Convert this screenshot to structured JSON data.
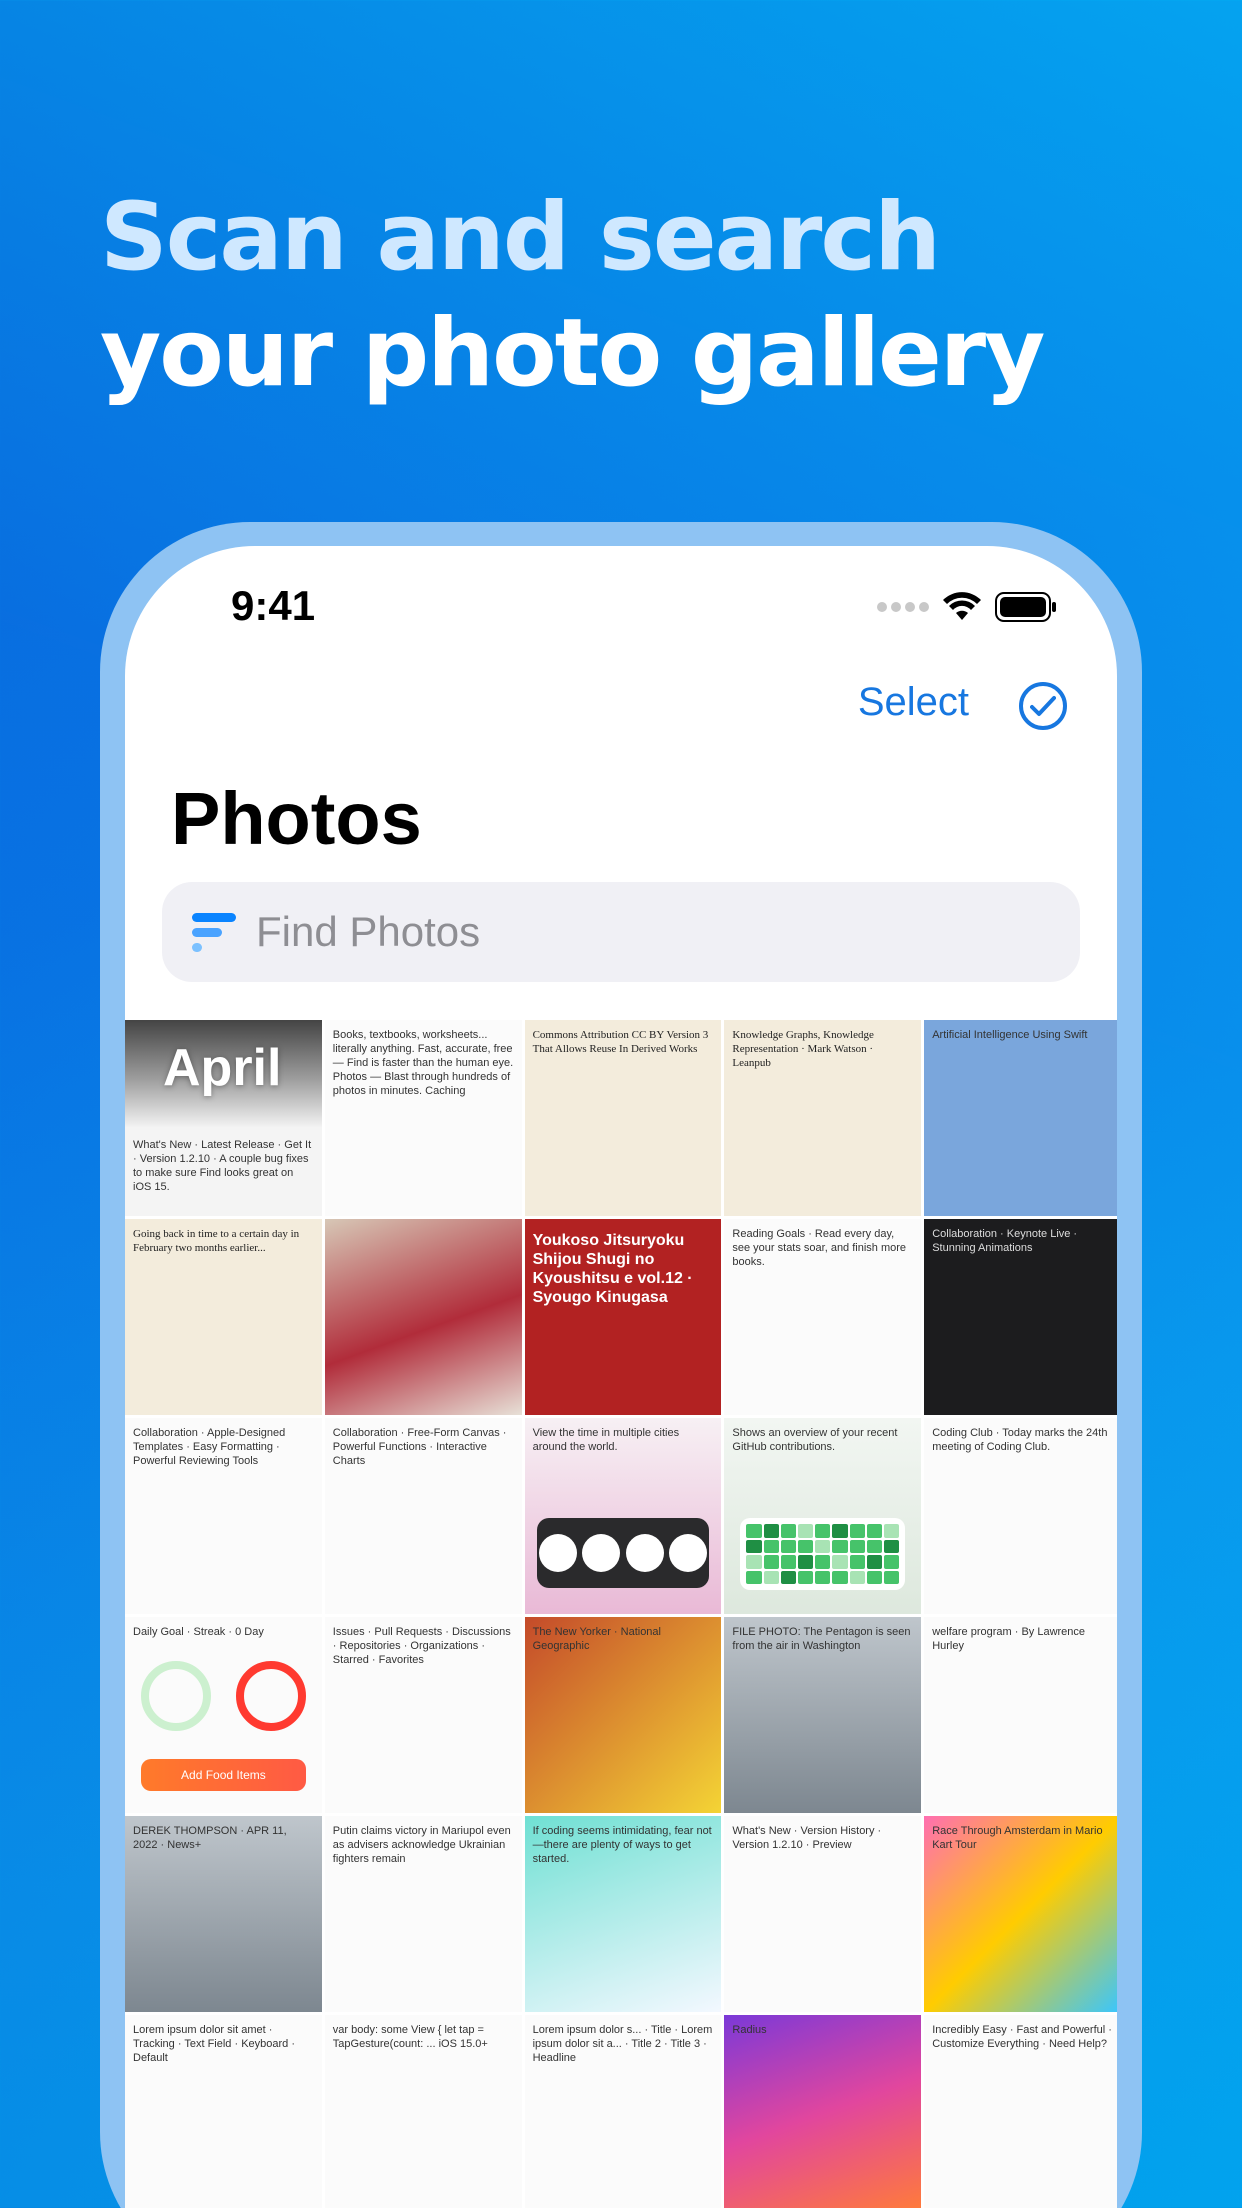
{
  "headline": {
    "line1": "Scan and search",
    "line2": "your photo gallery"
  },
  "status": {
    "time": "9:41"
  },
  "nav": {
    "select_label": "Select"
  },
  "page": {
    "title": "Photos"
  },
  "search": {
    "placeholder": "Find Photos"
  },
  "grid": {
    "section_label": "April",
    "tiles": [
      {
        "name": "whats-new-tile",
        "style": "april-tile",
        "caption": "What's New · Latest Release · Get It · Version 1.2.10 · A couple bug fixes to make sure Find looks great on iOS 15."
      },
      {
        "name": "features-list-tile",
        "style": "light",
        "caption": "Books, textbooks, worksheets... literally anything. Fast, accurate, free — Find is faster than the human eye. Photos — Blast through hundreds of photos in minutes. Caching"
      },
      {
        "name": "license-page-tile",
        "style": "paper",
        "caption": "Commons Attribution CC BY Version 3 That Allows Reuse In Derived Works"
      },
      {
        "name": "book-title-page-tile",
        "style": "paper",
        "caption": "Knowledge Graphs, Knowledge Representation · Mark Watson · Leanpub"
      },
      {
        "name": "book-cover-ai-tile",
        "style": "blue",
        "caption": "Artificial Intelligence Using Swift"
      },
      {
        "name": "novel-page-tile",
        "style": "paper",
        "caption": "Going back in time to a certain day in February two months earlier..."
      },
      {
        "name": "anime-cover-tile",
        "style": "anime",
        "caption": ""
      },
      {
        "name": "novel-cover-tile",
        "style": "red",
        "caption": "Youkoso Jitsuryoku Shijou Shugi no Kyoushitsu e vol.12 · Syougo Kinugasa"
      },
      {
        "name": "reading-goals-tile",
        "style": "light",
        "caption": "Reading Goals · Read every day, see your stats soar, and finish more books."
      },
      {
        "name": "keynote-features-tile",
        "style": "dark",
        "caption": "Collaboration · Keynote Live · Stunning Animations"
      },
      {
        "name": "pages-features-tile",
        "style": "light",
        "caption": "Collaboration · Apple-Designed Templates · Easy Formatting · Powerful Reviewing Tools"
      },
      {
        "name": "numbers-features-tile",
        "style": "light",
        "caption": "Collaboration · Free-Form Canvas · Powerful Functions · Interactive Charts"
      },
      {
        "name": "world-clock-tile",
        "style": "pink",
        "caption": "View the time in multiple cities around the world."
      },
      {
        "name": "github-widget-tile",
        "style": "green",
        "caption": "Shows an overview of your recent GitHub contributions."
      },
      {
        "name": "messages-tile",
        "style": "light",
        "caption": "Coding Club · Today marks the 24th meeting of Coding Club."
      },
      {
        "name": "daily-goal-tile",
        "style": "light",
        "caption": "Daily Goal · Streak · 0 Day"
      },
      {
        "name": "github-menu-tile",
        "style": "light",
        "caption": "Issues · Pull Requests · Discussions · Repositories · Organizations · Starred · Favorites"
      },
      {
        "name": "magazines-tile",
        "style": "mag",
        "caption": "The New Yorker · National Geographic"
      },
      {
        "name": "news-photo-tile",
        "style": "photo",
        "caption": "FILE PHOTO: The Pentagon is seen from the air in Washington"
      },
      {
        "name": "welfare-article-tile",
        "style": "light",
        "caption": "welfare program · By Lawrence Hurley"
      },
      {
        "name": "apple-news-tile",
        "style": "photo",
        "caption": "DEREK THOMPSON · APR 11, 2022 · News+"
      },
      {
        "name": "wapo-article-tile",
        "style": "light",
        "caption": "Putin claims victory in Mariupol even as advisers acknowledge Ukrainian fighters remain"
      },
      {
        "name": "robots-article-tile",
        "style": "robot",
        "caption": "If coding seems intimidating, fear not—there are plenty of ways to get started."
      },
      {
        "name": "app-store-tile",
        "style": "light",
        "caption": "What's New · Version History · Version 1.2.10 · Preview"
      },
      {
        "name": "mario-kart-tile",
        "style": "colorful",
        "caption": "Race Through Amsterdam in Mario Kart Tour"
      },
      {
        "name": "settings-tracking-tile",
        "style": "light",
        "caption": "Lorem ipsum dolor sit amet · Tracking · Text Field · Keyboard · Default"
      },
      {
        "name": "swift-code-tile",
        "style": "light",
        "caption": "var body: some View { let tap = TapGesture(count: ... iOS 15.0+"
      },
      {
        "name": "list-lorem-tile",
        "style": "light",
        "caption": "Lorem ipsum dolor s... · Title · Lorem ipsum dolor sit a... · Title 2 · Title 3 · Headline"
      },
      {
        "name": "wallpaper-tile",
        "style": "purple",
        "caption": "Radius"
      },
      {
        "name": "popovers-tile",
        "style": "light",
        "caption": "Incredibly Easy · Fast and Powerful · Customize Everything · Need Help?"
      }
    ]
  },
  "colors": {
    "accent": "#1777e0",
    "headline_light": "#cfe8ff"
  }
}
